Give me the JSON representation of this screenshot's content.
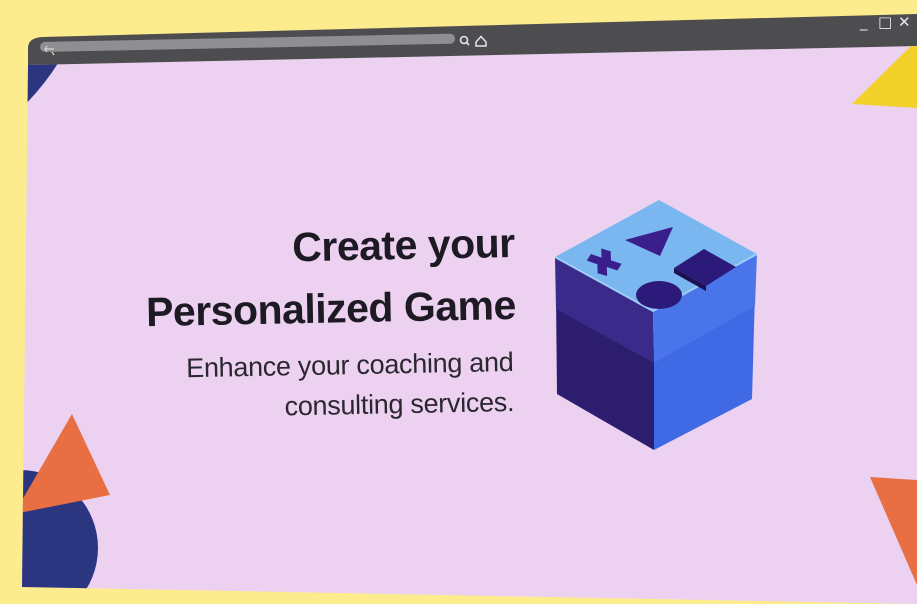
{
  "hero": {
    "title_line1": "Create your",
    "title_line2": "Personalized Game",
    "subtitle_line1": "Enhance your coaching and",
    "subtitle_line2": "consulting services."
  },
  "toolbar": {
    "icons": [
      "tabs-icon",
      "search-icon",
      "home-icon"
    ]
  },
  "window_controls": {
    "minimize": "_",
    "maximize": "□",
    "close": "✕"
  },
  "colors": {
    "background": "#fdec8e",
    "window_bg": "#ecd2f0",
    "titlebar": "#4d4d50",
    "navy": "#2b3580",
    "orange": "#e86f43",
    "yellow": "#f3d12b",
    "box_light": "#7ab6f0",
    "box_mid": "#4a6be0",
    "box_dark": "#2c1d6e"
  }
}
